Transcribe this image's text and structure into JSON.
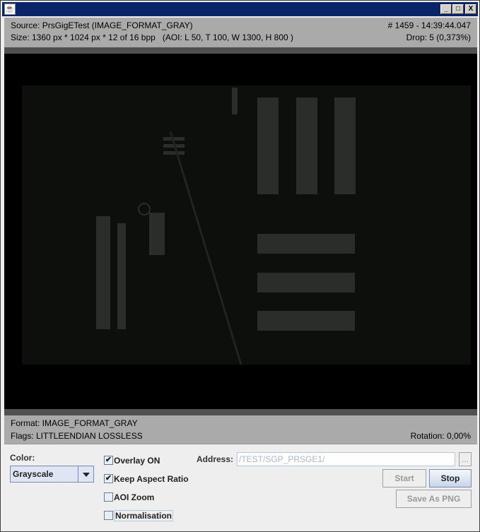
{
  "window": {
    "title": "",
    "controls": {
      "minimize": "_",
      "maximize": "□",
      "close": "X"
    }
  },
  "info": {
    "source": "Source: PrsGigETest (IMAGE_FORMAT_GRAY)",
    "frame": "# 1459 - 14:39:44.047",
    "size": "Size: 1360 px * 1024 px * 12 of 16 bpp   (AOI: L 50, T 100, W 1300, H 800 )",
    "drop": "Drop: 5 (0,373%)"
  },
  "status": {
    "format": "Format: IMAGE_FORMAT_GRAY",
    "flags": "Flags: LITTLEENDIAN LOSSLESS",
    "rotation": "Rotation: 0,00%"
  },
  "controls": {
    "color_label": "Color:",
    "color_value": "Grayscale",
    "checkboxes": [
      {
        "label": "Overlay ON",
        "checked": true
      },
      {
        "label": "Keep Aspect Ratio",
        "checked": true
      },
      {
        "label": "AOI Zoom",
        "checked": false
      },
      {
        "label": "Normalisation",
        "checked": false
      }
    ],
    "address_label": "Address:",
    "address_value": "/TEST/SGP_PRSGE1/",
    "browse": "...",
    "start": "Start",
    "stop": "Stop",
    "save": "Save As PNG"
  }
}
